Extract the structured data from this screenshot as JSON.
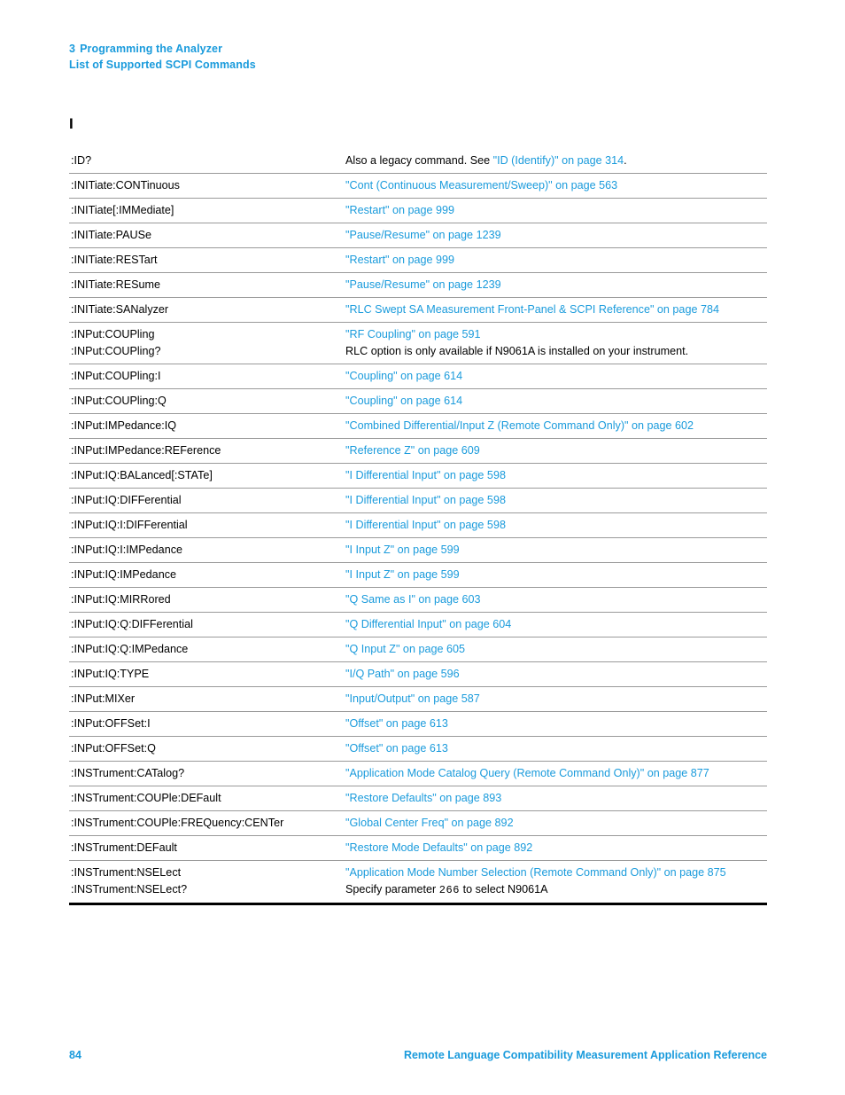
{
  "header": {
    "chapter_number": "3",
    "chapter_title": "Programming the Analyzer",
    "section_title": "List of Supported SCPI Commands"
  },
  "section_letter": "I",
  "colors": {
    "link_blue": "#1a9bdc",
    "text_black": "#000000",
    "rule_gray": "#9a9a9a"
  },
  "table": {
    "rows": [
      {
        "commands": [
          ":ID?"
        ],
        "description": [
          [
            {
              "t": "Also a legacy command. See ",
              "s": "plain"
            },
            {
              "t": "\"ID (Identify)\" on page 314",
              "s": "link"
            },
            {
              "t": ".",
              "s": "plain"
            }
          ]
        ]
      },
      {
        "commands": [
          ":INITiate:CONTinuous"
        ],
        "description": [
          [
            {
              "t": "\"Cont (Continuous Measurement/Sweep)\" on page 563",
              "s": "link"
            }
          ]
        ]
      },
      {
        "commands": [
          ":INITiate[:IMMediate]"
        ],
        "description": [
          [
            {
              "t": "\"Restart\" on page 999",
              "s": "link"
            }
          ]
        ]
      },
      {
        "commands": [
          ":INITiate:PAUSe"
        ],
        "description": [
          [
            {
              "t": "\"Pause/Resume\" on page 1239",
              "s": "link"
            }
          ]
        ]
      },
      {
        "commands": [
          ":INITiate:RESTart"
        ],
        "description": [
          [
            {
              "t": "\"Restart\" on page 999",
              "s": "link"
            }
          ]
        ]
      },
      {
        "commands": [
          ":INITiate:RESume"
        ],
        "description": [
          [
            {
              "t": "\"Pause/Resume\" on page 1239",
              "s": "link"
            }
          ]
        ]
      },
      {
        "commands": [
          ":INITiate:SANalyzer"
        ],
        "description": [
          [
            {
              "t": "\"RLC Swept SA Measurement Front-Panel & SCPI Reference\" on page 784",
              "s": "link"
            }
          ]
        ]
      },
      {
        "commands": [
          ":INPut:COUPling",
          ":INPut:COUPling?"
        ],
        "description": [
          [
            {
              "t": "\"RF Coupling\" on page 591",
              "s": "link"
            }
          ],
          [
            {
              "t": "RLC option is only available if N9061A is installed on your instrument.",
              "s": "plain"
            }
          ]
        ]
      },
      {
        "commands": [
          ":INPut:COUPling:I"
        ],
        "description": [
          [
            {
              "t": "\"Coupling\" on page 614",
              "s": "link"
            }
          ]
        ]
      },
      {
        "commands": [
          ":INPut:COUPling:Q"
        ],
        "description": [
          [
            {
              "t": "\"Coupling\" on page 614",
              "s": "link"
            }
          ]
        ]
      },
      {
        "commands": [
          ":INPut:IMPedance:IQ"
        ],
        "description": [
          [
            {
              "t": "\"Combined Differential/Input Z (Remote Command Only)\" on page 602",
              "s": "link"
            }
          ]
        ]
      },
      {
        "commands": [
          ":INPut:IMPedance:REFerence"
        ],
        "description": [
          [
            {
              "t": "\"Reference Z\" on page 609",
              "s": "link"
            }
          ]
        ]
      },
      {
        "commands": [
          ":INPut:IQ:BALanced[:STATe]"
        ],
        "description": [
          [
            {
              "t": "\"I Differential Input\" on page 598",
              "s": "link"
            }
          ]
        ]
      },
      {
        "commands": [
          ":INPut:IQ:DIFFerential"
        ],
        "description": [
          [
            {
              "t": "\"I Differential Input\" on page 598",
              "s": "link"
            }
          ]
        ]
      },
      {
        "commands": [
          ":INPut:IQ:I:DIFFerential"
        ],
        "description": [
          [
            {
              "t": "\"I Differential Input\" on page 598",
              "s": "link"
            }
          ]
        ]
      },
      {
        "commands": [
          ":INPut:IQ:I:IMPedance"
        ],
        "description": [
          [
            {
              "t": "\"I Input Z\" on page 599",
              "s": "link"
            }
          ]
        ]
      },
      {
        "commands": [
          ":INPut:IQ:IMPedance"
        ],
        "description": [
          [
            {
              "t": "\"I Input Z\" on page 599",
              "s": "link"
            }
          ]
        ]
      },
      {
        "commands": [
          ":INPut:IQ:MIRRored"
        ],
        "description": [
          [
            {
              "t": "\"Q Same as I\" on page 603",
              "s": "link"
            }
          ]
        ]
      },
      {
        "commands": [
          ":INPut:IQ:Q:DIFFerential"
        ],
        "description": [
          [
            {
              "t": "\"Q Differential Input\" on page 604",
              "s": "link"
            }
          ]
        ]
      },
      {
        "commands": [
          ":INPut:IQ:Q:IMPedance"
        ],
        "description": [
          [
            {
              "t": "\"Q Input Z\" on page 605",
              "s": "link"
            }
          ]
        ]
      },
      {
        "commands": [
          ":INPut:IQ:TYPE"
        ],
        "description": [
          [
            {
              "t": "\"I/Q Path\" on page 596",
              "s": "link"
            }
          ]
        ]
      },
      {
        "commands": [
          ":INPut:MIXer"
        ],
        "description": [
          [
            {
              "t": "\"Input/Output\" on page 587",
              "s": "link"
            }
          ]
        ]
      },
      {
        "commands": [
          ":INPut:OFFSet:I"
        ],
        "description": [
          [
            {
              "t": "\"Offset\" on page 613",
              "s": "link"
            }
          ]
        ]
      },
      {
        "commands": [
          ":INPut:OFFSet:Q"
        ],
        "description": [
          [
            {
              "t": "\"Offset\" on page 613",
              "s": "link"
            }
          ]
        ]
      },
      {
        "commands": [
          ":INSTrument:CATalog?"
        ],
        "description": [
          [
            {
              "t": "\"Application Mode Catalog Query (Remote Command Only)\" on page 877",
              "s": "link"
            }
          ]
        ]
      },
      {
        "commands": [
          ":INSTrument:COUPle:DEFault"
        ],
        "description": [
          [
            {
              "t": "\"Restore Defaults\" on page 893",
              "s": "link"
            }
          ]
        ]
      },
      {
        "commands": [
          ":INSTrument:COUPle:FREQuency:CENTer"
        ],
        "description": [
          [
            {
              "t": "\"Global Center Freq\" on page 892",
              "s": "link"
            }
          ]
        ]
      },
      {
        "commands": [
          ":INSTrument:DEFault"
        ],
        "description": [
          [
            {
              "t": "\"Restore Mode Defaults\" on page 892",
              "s": "link"
            }
          ]
        ]
      },
      {
        "commands": [
          ":INSTrument:NSELect",
          ":INSTrument:NSELect?"
        ],
        "description": [
          [
            {
              "t": "\"Application Mode Number Selection (Remote Command Only)\" on page 875",
              "s": "link"
            }
          ],
          [
            {
              "t": "Specify parameter ",
              "s": "plain"
            },
            {
              "t": "266",
              "s": "mono"
            },
            {
              "t": "  to select N9061A",
              "s": "plain"
            }
          ]
        ]
      }
    ]
  },
  "footer": {
    "page_number": "84",
    "book_title": "Remote Language Compatibility Measurement Application Reference"
  }
}
